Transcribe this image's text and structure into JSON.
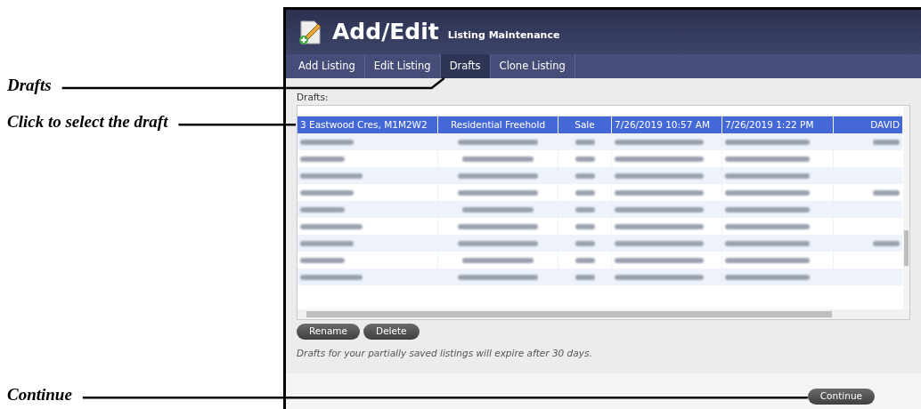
{
  "annotations": [
    {
      "label": "Drafts"
    },
    {
      "label": "Click to select the draft"
    },
    {
      "label": "Continue"
    }
  ],
  "window": {
    "title": "Add/Edit",
    "subtitle": "Listing Maintenance"
  },
  "tabs": [
    {
      "label": "Add Listing",
      "selected": false
    },
    {
      "label": "Edit Listing",
      "selected": false
    },
    {
      "label": "Drafts",
      "selected": true
    },
    {
      "label": "Clone Listing",
      "selected": false
    }
  ],
  "drafts_label": "Drafts:",
  "table": {
    "rows": [
      {
        "kind": "text",
        "selected": true,
        "cells": [
          "3 Eastwood Cres, M1M2W2",
          "Residential Freehold",
          "Sale",
          "7/26/2019 10:57 AM",
          "7/26/2019 1:22 PM",
          "DAVID"
        ]
      },
      {
        "kind": "redacted",
        "selected": false
      },
      {
        "kind": "redacted",
        "selected": false
      },
      {
        "kind": "redacted",
        "selected": false
      },
      {
        "kind": "redacted",
        "selected": false
      },
      {
        "kind": "redacted",
        "selected": false
      },
      {
        "kind": "redacted",
        "selected": false
      },
      {
        "kind": "redacted",
        "selected": false
      },
      {
        "kind": "redacted",
        "selected": false
      },
      {
        "kind": "redacted",
        "selected": false
      }
    ]
  },
  "buttons": [
    "Rename",
    "Delete"
  ],
  "note": "Drafts for your partially saved listings will expire after 30 days.",
  "continue_button": "Continue"
}
